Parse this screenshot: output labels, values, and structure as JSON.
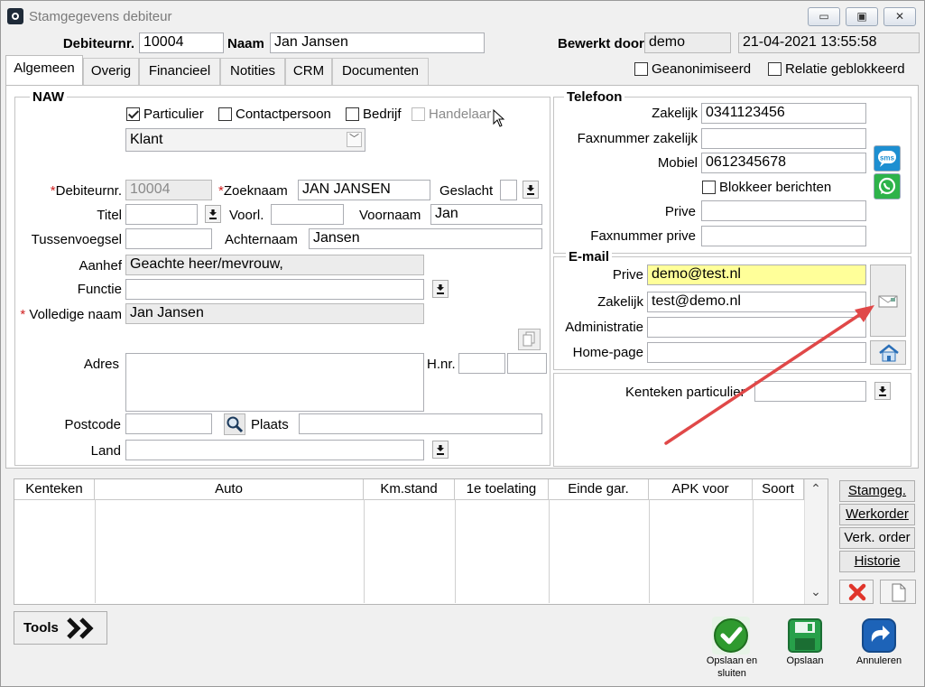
{
  "window": {
    "title": "Stamgegevens debiteur",
    "min": "▭",
    "max": "▣",
    "close": "✕"
  },
  "header": {
    "debnr_label": "Debiteurnr.",
    "debnr": "10004",
    "naam_label": "Naam",
    "naam": "Jan Jansen",
    "bewerkt_label": "Bewerkt door",
    "bewerkt": "demo",
    "datetime": "21-04-2021 13:55:58"
  },
  "tabs": [
    "Algemeen",
    "Overig",
    "Financieel",
    "Notities",
    "CRM",
    "Documenten"
  ],
  "flags": {
    "geanonimiseerd": "Geanonimiseerd",
    "geblokkeerd": "Relatie geblokkeerd"
  },
  "naw": {
    "title": "NAW",
    "particulier": "Particulier",
    "contactpersoon": "Contactpersoon",
    "bedrijf": "Bedrijf",
    "handelaar": "Handelaar",
    "type": "Klant",
    "debnr_label": "*Debiteurnr.",
    "debnr": "10004",
    "zoeknaam_label": "*Zoeknaam",
    "zoeknaam": "JAN JANSEN",
    "geslacht_label": "Geslacht",
    "titel_label": "Titel",
    "voorl_label": "Voorl.",
    "voornaam_label": "Voornaam",
    "voornaam": "Jan",
    "tussen_label": "Tussenvoegsel",
    "achternaam_label": "Achternaam",
    "achternaam": "Jansen",
    "aanhef_label": "Aanhef",
    "aanhef": "Geachte heer/mevrouw,",
    "functie_label": "Functie",
    "volnaam_label": "* Volledige naam",
    "volnaam": "Jan Jansen",
    "adres_label": "Adres",
    "hnr_label": "H.nr.",
    "postcode_label": "Postcode",
    "plaats_label": "Plaats",
    "land_label": "Land"
  },
  "telefoon": {
    "title": "Telefoon",
    "zakelijk_label": "Zakelijk",
    "zakelijk": "0341123456",
    "faxz_label": "Faxnummer zakelijk",
    "mobiel_label": "Mobiel",
    "mobiel": "0612345678",
    "sms": "sms",
    "blokkeer": "Blokkeer berichten",
    "prive_label": "Prive",
    "faxp_label": "Faxnummer prive"
  },
  "email": {
    "title": "E-mail",
    "prive_label": "Prive",
    "prive": "demo@test.nl",
    "zakelijk_label": "Zakelijk",
    "zakelijk": "test@demo.nl",
    "admin_label": "Administratie",
    "home_label": "Home-page"
  },
  "kenteken": {
    "label": "Kenteken particulier"
  },
  "table": {
    "headers": [
      "Kenteken",
      "Auto",
      "Km.stand",
      "1e toelating",
      "Einde gar.",
      "APK voor",
      "Soort"
    ],
    "scroll_up": "⌃",
    "scroll_down": "⌄"
  },
  "side_buttons": {
    "stamgeg": "Stamgeg.",
    "werkorder": "Werkorder",
    "verkorder": "Verk. order",
    "historie": "Historie"
  },
  "tools": "Tools",
  "actions": {
    "opslaan_sluiten_1": "Opslaan en",
    "opslaan_sluiten_2": "sluiten",
    "opslaan": "Opslaan",
    "annuleren": "Annuleren"
  },
  "colors": {
    "arrow": "#e04848",
    "ok": "#2f9a2f",
    "save": "#27a04a",
    "cancel": "#1d63b8"
  }
}
